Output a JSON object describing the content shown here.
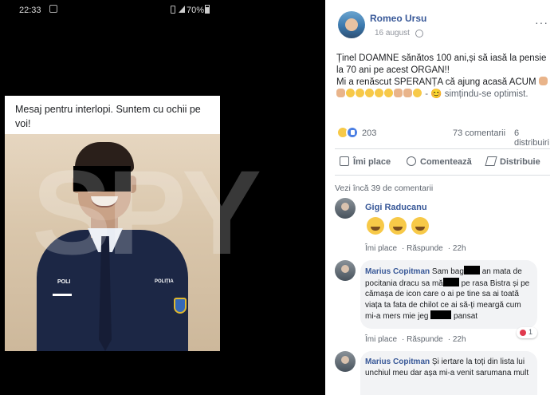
{
  "status_bar": {
    "time": "22:33",
    "battery": "70%"
  },
  "shared_post": {
    "caption": "Mesaj pentru interlopi. Suntem cu ochii pe voi!",
    "uniform_label_left": "POLI",
    "uniform_label_right": "POLIȚIA"
  },
  "watermark": {
    "text": "SPY"
  },
  "post": {
    "author": "Romeo Ursu",
    "date": "16 august",
    "text_line1": "Ținel DOAMNE sănătos 100 ani,și să iasă la pensie la 70 ani pe acest ORGAN!!",
    "text_line2": "Mi a renăscut SPERANȚA că ajung acasă ACUM",
    "feeling": "- 😊 simțindu-se optimist.",
    "reaction_count": "203",
    "comments_count": "73 comentarii",
    "shares_count": "6 distribuiri",
    "actions": {
      "like": "Îmi place",
      "comment": "Comentează",
      "share": "Distribuie"
    },
    "more_comments": "Vezi încă 39 de comentarii"
  },
  "comments": [
    {
      "name": "Gigi Raducanu",
      "like": "Îmi place",
      "reply": "Răspunde",
      "time": "22h"
    },
    {
      "name": "Marius Copitman",
      "text_a": "Sam bag",
      "text_b": "an mata de pocitania dracu sa mă",
      "text_c": "pe rasa Bistra și pe cămașa de icon care o ai pe tine sa ai toată viața ta fata de chilot ce ai să-ți meargă cum mi-a mers mie jeg",
      "text_d": "pansat",
      "reaction_count": "1",
      "like": "Îmi place",
      "reply": "Răspunde",
      "time": "22h"
    },
    {
      "name": "Marius Copitman",
      "text": "Și iertare la toți din lista lui unchiul meu dar așa mi-a venit sarumana mult"
    }
  ],
  "colors": {
    "fb_link": "#385898",
    "fb_meta": "#606770",
    "like_blue": "#4a7ee3"
  }
}
